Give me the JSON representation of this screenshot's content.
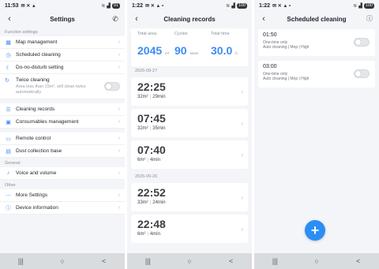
{
  "colors": {
    "accent": "#3f8cf5",
    "fab": "#2b8ef5",
    "background": "#f3f5f8",
    "navbar": "#d9dcdf"
  },
  "settings_screen": {
    "status": {
      "time": "11:53",
      "battery": "91"
    },
    "title": "Settings",
    "back_icon": "back-arrow-icon",
    "phone_icon": "phone-icon",
    "section_function": "Function settings",
    "items_function": [
      {
        "label": "Map management",
        "icon": "map-icon"
      },
      {
        "label": "Scheduled cleaning",
        "icon": "clock-icon"
      },
      {
        "label": "Do-no-disturb setting",
        "icon": "moon-icon"
      }
    ],
    "twice_cleaning": {
      "label": "Twice cleaning",
      "description": "Area less than 15m², will clean twice automatically"
    },
    "items_records": [
      {
        "label": "Cleaning records",
        "icon": "list-icon"
      },
      {
        "label": "Consumables management",
        "icon": "box-icon"
      }
    ],
    "items_device": [
      {
        "label": "Remote control",
        "icon": "remote-icon"
      },
      {
        "label": "Dust collection base",
        "icon": "base-icon"
      }
    ],
    "section_general": "General",
    "items_general": [
      {
        "label": "Voice and volume",
        "icon": "speaker-icon"
      }
    ],
    "section_other": "Other",
    "items_other": [
      {
        "label": "More Settings",
        "icon": "more-icon"
      },
      {
        "label": "Device information",
        "icon": "info-icon"
      }
    ]
  },
  "records_screen": {
    "status": {
      "time": "1:22",
      "battery": "100"
    },
    "title": "Cleaning records",
    "stats": {
      "total_area_label": "Total area",
      "total_area_value": "2045",
      "total_area_unit": "m²",
      "cycles_label": "Cycles",
      "cycles_value": "90",
      "cycles_unit": "times",
      "total_time_label": "Total time",
      "total_time_value": "30.0",
      "total_time_unit": "h"
    },
    "groups": [
      {
        "date": "2025-09-27",
        "records": [
          {
            "time": "22:25",
            "area": "32m²",
            "duration": "29min"
          },
          {
            "time": "07:45",
            "area": "32m²",
            "duration": "35min"
          },
          {
            "time": "07:40",
            "area": "6m²",
            "duration": "4min"
          }
        ]
      },
      {
        "date": "2025-09-26",
        "records": [
          {
            "time": "22:52",
            "area": "33m²",
            "duration": "24min"
          },
          {
            "time": "22:48",
            "area": "6m²",
            "duration": "4min"
          }
        ]
      }
    ]
  },
  "schedule_screen": {
    "status": {
      "time": "1:22",
      "battery": "100"
    },
    "title": "Scheduled cleaning",
    "info_icon": "info-icon",
    "schedules": [
      {
        "time": "01:50",
        "repeat": "One-time only",
        "mode": "Auto cleaning | Mop | High"
      },
      {
        "time": "03:00",
        "repeat": "One-time only",
        "mode": "Auto cleaning | Mop | High"
      }
    ],
    "add_label": "+"
  },
  "navbar": {
    "recents": "|||",
    "home": "○",
    "back": "<"
  }
}
